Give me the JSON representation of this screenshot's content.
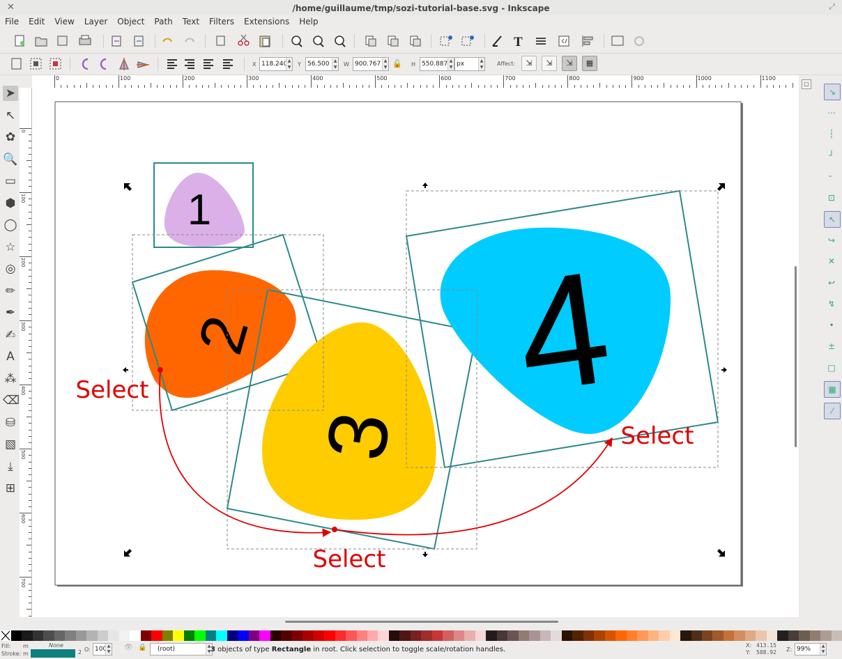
{
  "window": {
    "title": "/home/guillaume/tmp/sozi-tutorial-base.svg - Inkscape",
    "close_glyph": "✕",
    "maximize_glyph": "⤢"
  },
  "menu": [
    "File",
    "Edit",
    "View",
    "Layer",
    "Object",
    "Path",
    "Text",
    "Filters",
    "Extensions",
    "Help"
  ],
  "command_bar": {
    "icons": [
      "new-document-icon",
      "open-icon",
      "save-template-icon",
      "print-icon",
      "import-icon",
      "export-icon",
      "undo-icon",
      "redo-icon",
      "copy-icon",
      "cut-icon",
      "paste-icon",
      "zoom-selection-icon",
      "zoom-drawing-icon",
      "zoom-page-icon",
      "duplicate-icon",
      "clone-icon",
      "unlink-clone-icon",
      "group-icon",
      "ungroup-icon",
      "fill-stroke-icon",
      "text-font-icon",
      "layers-icon",
      "xml-editor-icon",
      "align-icon",
      "document-properties-icon",
      "preferences-icon"
    ]
  },
  "controls": {
    "x_label": "X",
    "x_value": "118.240",
    "y_label": "Y",
    "y_value": "56.500",
    "w_label": "W",
    "w_value": "900.767",
    "h_label": "H",
    "h_value": "550.887",
    "unit": "px",
    "affect_label": "Affect:",
    "lock_glyph": "🔓"
  },
  "ruler": {
    "h_labels": [
      "0",
      "100",
      "200",
      "300",
      "400",
      "500",
      "600",
      "700",
      "800",
      "900",
      "1000",
      "1100"
    ],
    "v_labels": [
      "0",
      "100",
      "200",
      "300",
      "400",
      "500",
      "600",
      "700"
    ]
  },
  "tools": [
    {
      "name": "selector-tool-icon",
      "glyph": "➤",
      "active": true
    },
    {
      "name": "node-tool-icon",
      "glyph": "↖"
    },
    {
      "name": "tweak-tool-icon",
      "glyph": "✿"
    },
    {
      "name": "zoom-tool-icon",
      "glyph": "🔍"
    },
    {
      "name": "rectangle-tool-icon",
      "glyph": "▭"
    },
    {
      "name": "box-3d-tool-icon",
      "glyph": "⬢"
    },
    {
      "name": "ellipse-tool-icon",
      "glyph": "◯"
    },
    {
      "name": "star-tool-icon",
      "glyph": "☆"
    },
    {
      "name": "spiral-tool-icon",
      "glyph": "◎"
    },
    {
      "name": "pencil-tool-icon",
      "glyph": "✏"
    },
    {
      "name": "pen-tool-icon",
      "glyph": "✒"
    },
    {
      "name": "calligraphy-tool-icon",
      "glyph": "✍"
    },
    {
      "name": "text-tool-icon",
      "glyph": "A"
    },
    {
      "name": "spray-tool-icon",
      "glyph": "⁂"
    },
    {
      "name": "eraser-tool-icon",
      "glyph": "⌫"
    },
    {
      "name": "paint-bucket-tool-icon",
      "glyph": "⛁"
    },
    {
      "name": "gradient-tool-icon",
      "glyph": "▧"
    },
    {
      "name": "dropper-tool-icon",
      "glyph": "⤓"
    },
    {
      "name": "connector-tool-icon",
      "glyph": "⊞"
    }
  ],
  "canvas": {
    "frames": [
      {
        "label": "1",
        "fill": "#dbb0e8"
      },
      {
        "label": "2",
        "fill": "#ff6600"
      },
      {
        "label": "3",
        "fill": "#ffcc00"
      },
      {
        "label": "4",
        "fill": "#00ccff"
      }
    ],
    "frame_stroke": "#2a8a8a",
    "annotation_color": "#e00000",
    "annotations": [
      "Select",
      "Select",
      "Select"
    ]
  },
  "snap": {
    "icons": [
      "snap-toggle-icon",
      "snap-bbox-icon",
      "snap-bbox-edge-icon",
      "snap-bbox-corner-icon",
      "snap-bbox-midpoint-icon",
      "snap-bbox-center-icon",
      "snap-nodes-icon",
      "snap-path-icon",
      "snap-intersection-icon",
      "snap-smooth-node-icon",
      "snap-midpoint-icon",
      "snap-center-icon",
      "snap-rotation-center-icon",
      "snap-page-border-icon",
      "snap-grid-icon",
      "snap-guide-icon"
    ]
  },
  "palette": [
    "#000000",
    "#1a1a1a",
    "#333333",
    "#4d4d4d",
    "#666666",
    "#808080",
    "#999999",
    "#b3b3b3",
    "#cccccc",
    "#e6e6e6",
    "#f2f2f2",
    "#ffffff",
    "#800000",
    "#ff0000",
    "#808000",
    "#ffff00",
    "#008000",
    "#00ff00",
    "#008080",
    "#00ffff",
    "#000080",
    "#0000ff",
    "#800080",
    "#ff00ff",
    "#2b0000",
    "#550000",
    "#800000",
    "#aa0000",
    "#d40000",
    "#ff0000",
    "#ff2a2a",
    "#ff5555",
    "#ff8080",
    "#ffaaaa",
    "#ffd5d5",
    "#280b0b",
    "#501616",
    "#782121",
    "#a02c2c",
    "#c83737",
    "#d35f5f",
    "#de8787",
    "#e9afaf",
    "#f4d7d7",
    "#241c1c",
    "#483737",
    "#6c5353",
    "#917c6f",
    "#ac9393",
    "#c8b7b7",
    "#e3dbdb",
    "#2b1100",
    "#552200",
    "#803300",
    "#aa4400",
    "#d45500",
    "#ff6600",
    "#ff7f2a",
    "#ff9955",
    "#ffb380",
    "#ffccaa",
    "#ffe6d5",
    "#28170b",
    "#502d16",
    "#784421",
    "#a05a2c",
    "#c87137",
    "#d38d5f",
    "#deaa87",
    "#e9c6af",
    "#f4e3d7",
    "#241f1c",
    "#483e37",
    "#6c5d53",
    "#917c6f",
    "#ac9d93",
    "#c8beb7"
  ],
  "status": {
    "fill_label": "Fill:",
    "fill_value": "m",
    "fill_none": "None",
    "stroke_label": "Stroke:",
    "stroke_value": "m",
    "stroke_color": "#0e8080",
    "stroke_width": "2",
    "opacity_label": "O:",
    "opacity_value": "100",
    "layer": "(root)",
    "message_count": "3",
    "message_mid": " objects of type ",
    "message_type": "Rectangle",
    "message_tail": " in root. Click selection to toggle scale/rotation handles.",
    "coord_x_label": "X:",
    "coord_x": "413.15",
    "coord_y_label": "Y:",
    "coord_y": "588.92",
    "zoom_label": "Z:",
    "zoom_value": "99%"
  }
}
